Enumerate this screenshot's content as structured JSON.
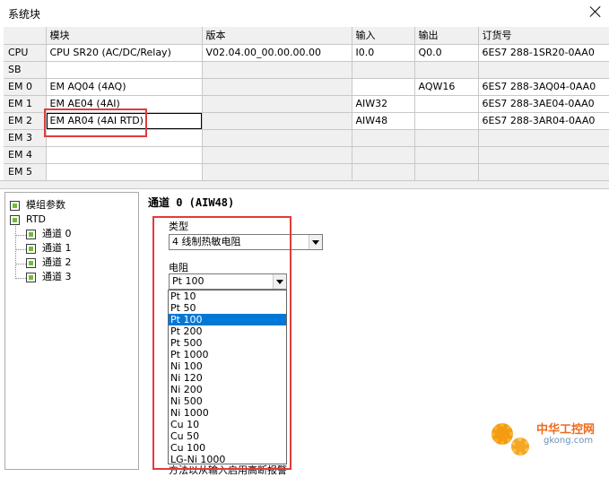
{
  "window": {
    "title": "系统块"
  },
  "grid": {
    "columns": [
      "",
      "模块",
      "版本",
      "输入",
      "输出",
      "订货号"
    ],
    "rows": [
      {
        "slot": "CPU",
        "module": "CPU SR20 (AC/DC/Relay)",
        "version": "V02.04.00_00.00.00.00",
        "input": "I0.0",
        "output": "Q0.0",
        "order": "6ES7 288-1SR20-0AA0"
      },
      {
        "slot": "SB",
        "module": "",
        "version": "",
        "input": "",
        "output": "",
        "order": ""
      },
      {
        "slot": "EM 0",
        "module": "EM AQ04 (4AQ)",
        "version": "",
        "input": "",
        "output": "AQW16",
        "order": "6ES7 288-3AQ04-0AA0"
      },
      {
        "slot": "EM 1",
        "module": "EM AE04 (4AI)",
        "version": "",
        "input": "AIW32",
        "output": "",
        "order": "6ES7 288-3AE04-0AA0"
      },
      {
        "slot": "EM 2",
        "module": "EM AR04 (4AI RTD)",
        "version": "",
        "input": "AIW48",
        "output": "",
        "order": "6ES7 288-3AR04-0AA0"
      },
      {
        "slot": "EM 3",
        "module": "",
        "version": "",
        "input": "",
        "output": "",
        "order": ""
      },
      {
        "slot": "EM 4",
        "module": "",
        "version": "",
        "input": "",
        "output": "",
        "order": ""
      },
      {
        "slot": "EM 5",
        "module": "",
        "version": "",
        "input": "",
        "output": "",
        "order": ""
      }
    ]
  },
  "tree": {
    "items": [
      {
        "label": "模组参数"
      },
      {
        "label": "RTD"
      },
      {
        "label": "通道 0"
      },
      {
        "label": "通道 1"
      },
      {
        "label": "通道 2"
      },
      {
        "label": "通道 3"
      }
    ]
  },
  "panel": {
    "title": "通道 0 (AIW48)",
    "type_label": "类型",
    "type_value": "4 线制热敏电阻",
    "resistance_label": "电阻",
    "resistance_value": "Pt 100",
    "options": [
      "Pt 10",
      "Pt 50",
      "Pt 100",
      "Pt 200",
      "Pt 500",
      "Pt 1000",
      "Ni 100",
      "Ni 120",
      "Ni 200",
      "Ni 500",
      "Ni 1000",
      "Cu 10",
      "Cu 50",
      "Cu 100",
      "LG-Ni 1000"
    ],
    "selected_option": "Pt 100",
    "hint": "方法以从输入启用高断报警"
  },
  "watermark": {
    "brand": "中华工控网",
    "site": "gkong.com"
  },
  "colors": {
    "highlight": "#e23b3b",
    "selection": "#0078d7",
    "tree_icon": "#6bbf34"
  }
}
